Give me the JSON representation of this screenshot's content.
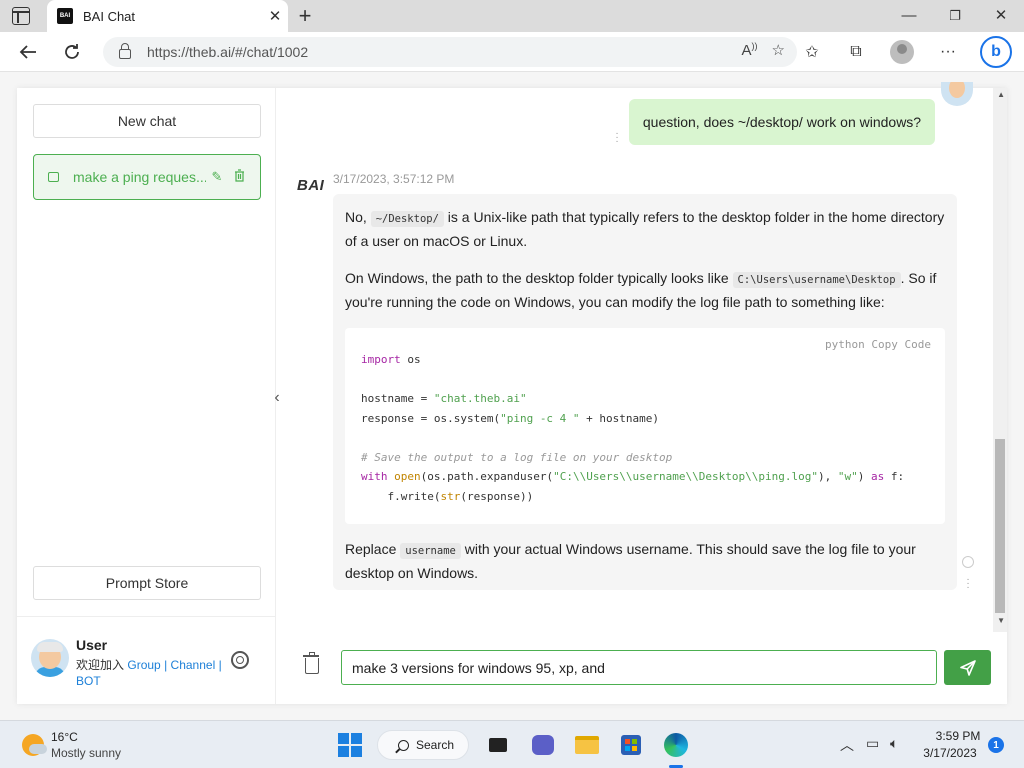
{
  "browser": {
    "tab_title": "BAI Chat",
    "favicon_text": "BAI",
    "url": "https://theb.ai/#/chat/1002"
  },
  "sidebar": {
    "new_chat_label": "New chat",
    "chats": [
      {
        "title": "make a ping reques..."
      }
    ],
    "prompt_store_label": "Prompt Store",
    "user": {
      "name": "User",
      "desc_prefix": "欢迎加入",
      "link_group": "Group",
      "separator": "|",
      "link_channel": "Channel",
      "link_bot": "BOT"
    }
  },
  "conversation": {
    "user_message": "question, does ~/desktop/ work on windows?",
    "bot_logo": "BAI",
    "bot_timestamp": "3/17/2023, 3:57:12 PM",
    "bot_p1_a": "No, ",
    "bot_p1_code": "~/Desktop/",
    "bot_p1_b": " is a Unix-like path that typically refers to the desktop folder in the home directory of a user on macOS or Linux.",
    "bot_p2_a": "On Windows, the path to the desktop folder typically looks like ",
    "bot_p2_code": "C:\\Users\\username\\Desktop",
    "bot_p2_b": ". So if you're running the code on Windows, you can modify the log file path to something like:",
    "code_lang": "python",
    "code_copy": "Copy Code",
    "bot_p3_a": "Replace ",
    "bot_p3_code": "username",
    "bot_p3_b": " with your actual Windows username. This should save the log file to your desktop on Windows."
  },
  "code_lines": [
    "import os",
    "",
    "hostname = \"chat.theb.ai\"",
    "response = os.system(\"ping -c 4 \" + hostname)",
    "",
    "# Save the output to a log file on your desktop",
    "with open(os.path.expanduser(\"C:\\\\Users\\\\username\\\\Desktop\\\\ping.log\"), \"w\") as f:",
    "    f.write(str(response))"
  ],
  "composer": {
    "input_value": "make 3 versions for windows 95, xp, and"
  },
  "taskbar": {
    "temperature": "16°C",
    "weather": "Mostly sunny",
    "search_label": "Search",
    "time": "3:59 PM",
    "date": "3/17/2023",
    "notification_count": "1"
  },
  "colors": {
    "accent_green": "#43a047",
    "user_bubble": "#d9f5d0",
    "link_blue": "#1e80d8"
  }
}
